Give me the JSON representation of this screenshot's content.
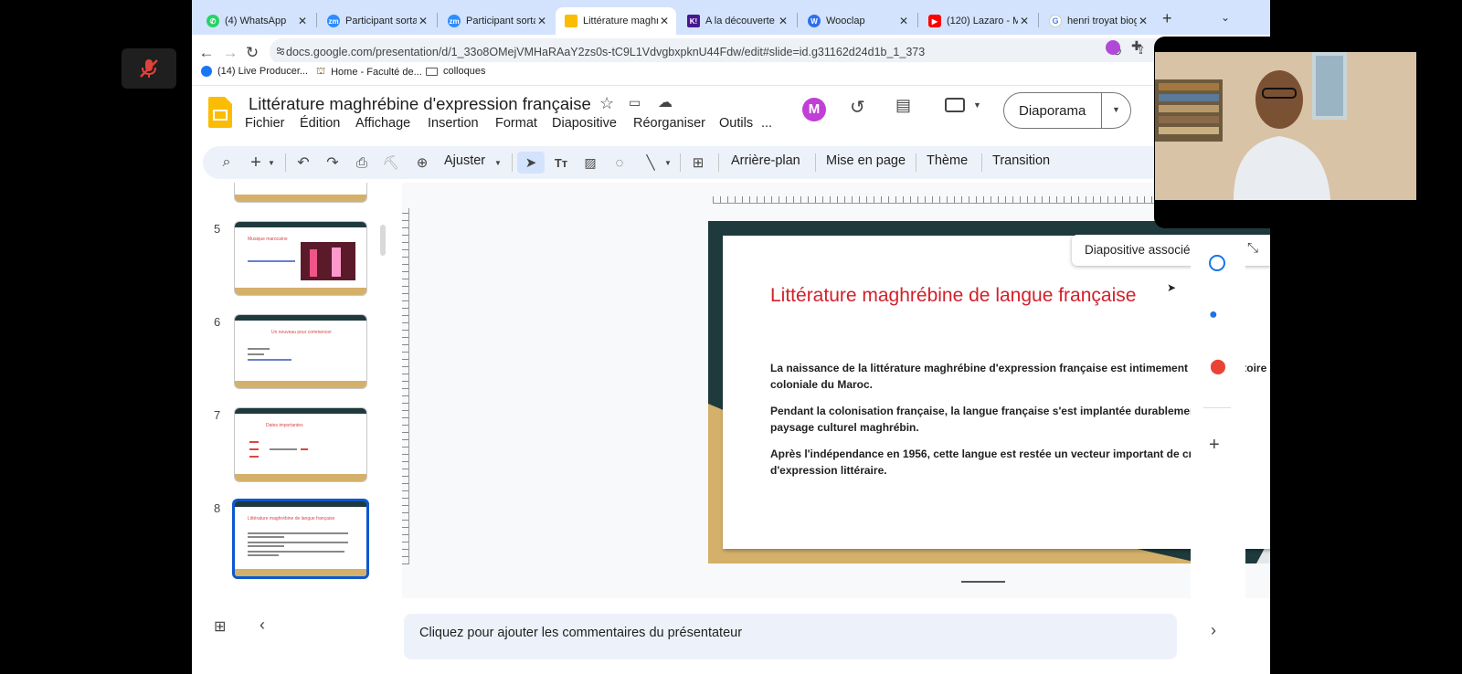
{
  "browser": {
    "tabs": [
      {
        "label": "(4) WhatsApp",
        "icon": "whatsapp-icon",
        "color": "#25d366"
      },
      {
        "label": "Participant sortan",
        "icon": "zoom-icon",
        "color": "#2d8cff"
      },
      {
        "label": "Participant sortan",
        "icon": "zoom-icon",
        "color": "#2d8cff"
      },
      {
        "label": "Littérature maghr",
        "icon": "slides-icon",
        "color": "#fbbc04"
      },
      {
        "label": "A la découverte d",
        "icon": "kahoot-icon",
        "color": "#46178f"
      },
      {
        "label": "Wooclap",
        "icon": "wooclap-icon",
        "color": "#2f6fed"
      },
      {
        "label": "(120) Lazaro - M",
        "icon": "youtube-icon",
        "color": "#ff0000"
      },
      {
        "label": "henri troyat biogr",
        "icon": "google-icon",
        "color": "#4285f4"
      }
    ],
    "url": "docs.google.com/presentation/d/1_33o8OMejVMHaRAaY2zs0s-tC9L1VdvgbxpknU44Fdw/edit#slide=id.g31162d24d1b_1_373",
    "bookmarks": [
      {
        "label": "(14) Live Producer...",
        "icon": "facebook-icon"
      },
      {
        "label": "Home - Faculté de...",
        "icon": "faculty-icon"
      },
      {
        "label": "colloques",
        "icon": "folder-icon"
      }
    ]
  },
  "app": {
    "title": "Littérature maghrébine d'expression française",
    "menus": [
      "Fichier",
      "Édition",
      "Affichage",
      "Insertion",
      "Format",
      "Diapositive",
      "Réorganiser",
      "Outils",
      "..."
    ],
    "present_label": "Diaporama",
    "toolbar": {
      "zoom_label": "Ajuster",
      "background": "Arrière-plan",
      "layout": "Mise en page",
      "theme": "Thème",
      "transition": "Transition"
    }
  },
  "filmstrip": {
    "slides": [
      {
        "number": "5",
        "title": "Musique marocaine",
        "selected": false
      },
      {
        "number": "6",
        "title": "Un nouveau pour commencer",
        "selected": false
      },
      {
        "number": "7",
        "title": "Dates importantes",
        "selected": false
      },
      {
        "number": "8",
        "title": "Littérature maghrébine de langue française",
        "selected": true
      }
    ]
  },
  "slide": {
    "title": "Littérature maghrébine de langue française",
    "paragraphs": [
      "La naissance de la littérature maghrébine d'expression française est intimement liée à l'histoire coloniale du Maroc.",
      "Pendant la colonisation  française, la langue française s'est implantée durablement dans le paysage culturel maghrébin.",
      "Après l'indépendance en 1956, cette langue est restée un vecteur important de création et d'expression littéraire."
    ],
    "linked_label": "Diapositive associée"
  },
  "notes": {
    "placeholder": "Cliquez pour ajouter les commentaires du présentateur"
  },
  "colors": {
    "accent_blue": "#0b57d0",
    "slide_dark": "#1f3a3d",
    "slide_gold": "#d4b06a",
    "slide_title_red": "#d3202a"
  }
}
